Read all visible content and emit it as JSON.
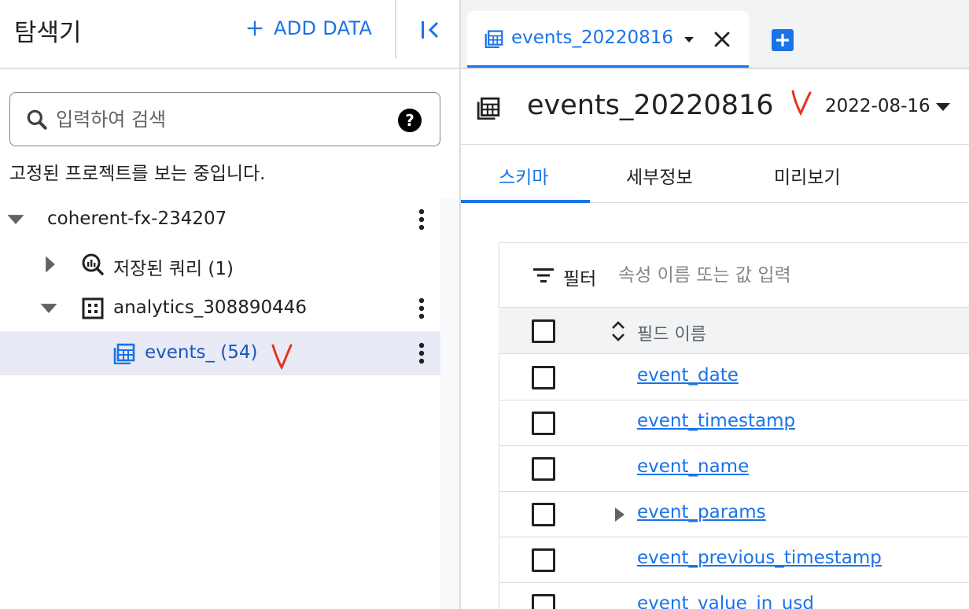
{
  "explorer": {
    "title": "탐색기",
    "add_data_label": "ADD DATA",
    "search_placeholder": "입력하여 검색",
    "pinned_note": "고정된 프로젝트를 보는 중입니다.",
    "tree": {
      "project": "coherent-fx-234207",
      "saved_queries": "저장된 쿼리 (1)",
      "dataset": "analytics_308890446",
      "table": "events_ (54)"
    }
  },
  "tab": {
    "label": "events_20220816"
  },
  "header": {
    "title": "events_20220816",
    "date": "2022-08-16"
  },
  "subtabs": [
    "스키마",
    "세부정보",
    "미리보기"
  ],
  "filter": {
    "label": "필터",
    "placeholder": "속성 이름 또는 값 입력"
  },
  "schema": {
    "column_header": "필드 이름",
    "fields": [
      {
        "name": "event_date",
        "expandable": false
      },
      {
        "name": "event_timestamp",
        "expandable": false
      },
      {
        "name": "event_name",
        "expandable": false
      },
      {
        "name": "event_params",
        "expandable": true
      },
      {
        "name": "event_previous_timestamp",
        "expandable": false
      },
      {
        "name": "event_value_in_usd",
        "expandable": false
      }
    ]
  },
  "colors": {
    "accent": "#1a73e8",
    "selected_row": "#e8eaf6",
    "annotation": "#e8311f"
  }
}
